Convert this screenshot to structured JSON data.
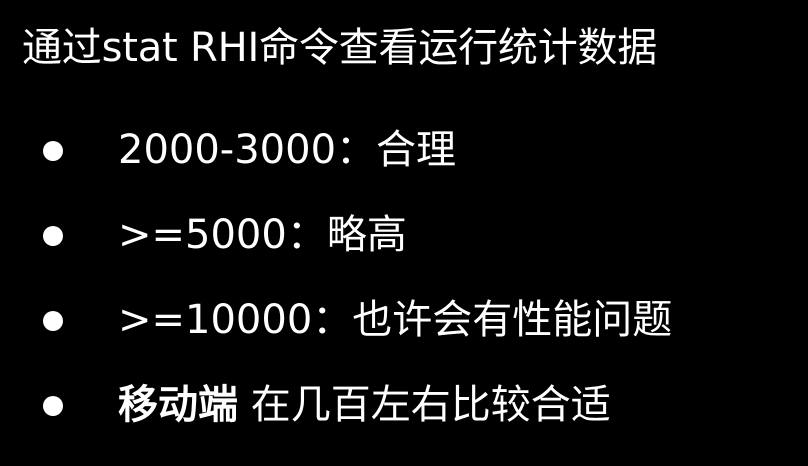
{
  "title": "通过stat RHI命令查看运行统计数据",
  "bullets": [
    {
      "prefix": "",
      "text": "2000-3000：合理"
    },
    {
      "prefix": "",
      "text": ">=5000：略高"
    },
    {
      "prefix": "",
      "text": ">=10000：也许会有性能问题"
    },
    {
      "prefix": "移动端",
      "text": " 在几百左右比较合适"
    }
  ],
  "colors": {
    "background": "#000000",
    "text": "#ffffff"
  }
}
